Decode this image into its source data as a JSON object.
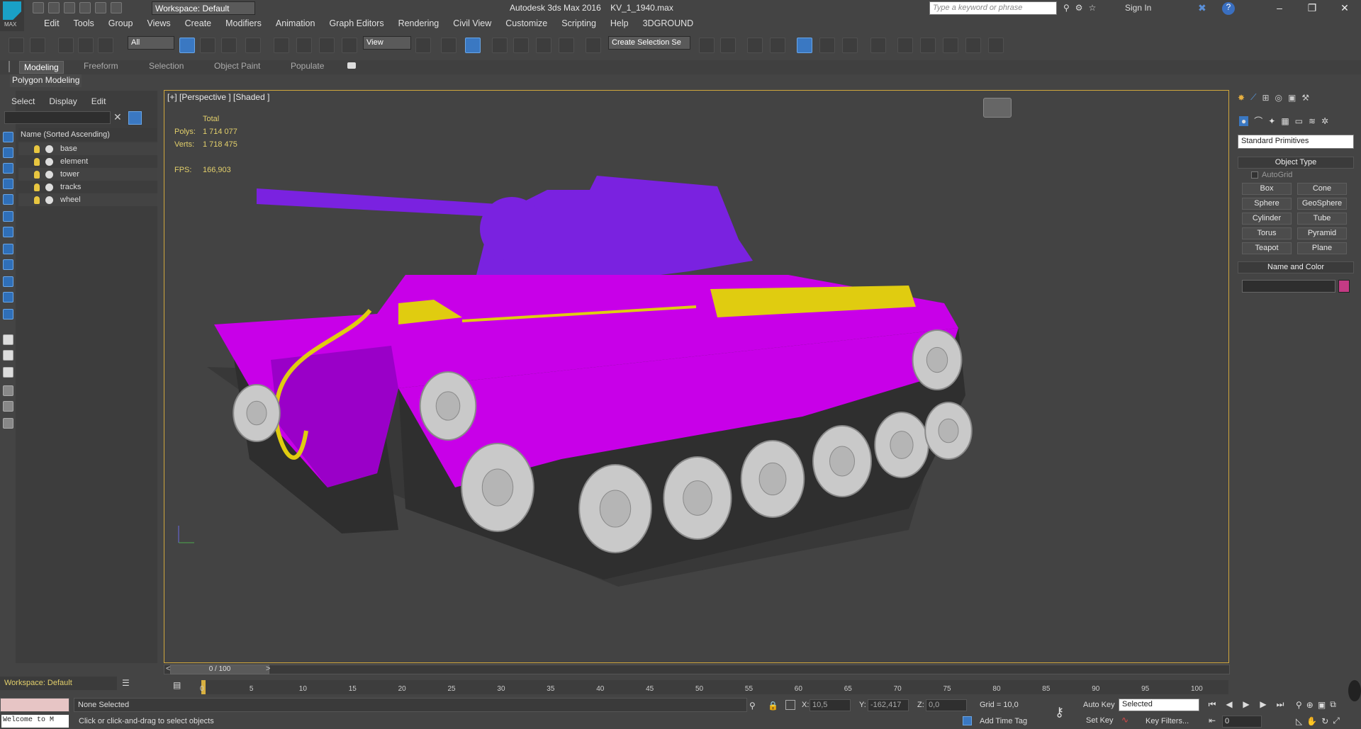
{
  "app": {
    "window_title": "Autodesk 3ds Max 2016",
    "file_name": "KV_1_1940.max",
    "logo_text": "MAX",
    "workspace_label": "Workspace: Default",
    "search_placeholder": "Type a keyword or phrase",
    "sign_in": "Sign In"
  },
  "menu": [
    "Edit",
    "Tools",
    "Group",
    "Views",
    "Create",
    "Modifiers",
    "Animation",
    "Graph Editors",
    "Rendering",
    "Civil View",
    "Customize",
    "Scripting",
    "Help",
    "3DGROUND"
  ],
  "toolbar": {
    "selection_filter": "All",
    "ref_coord": "View",
    "named_selection_placeholder": "Create Selection Se"
  },
  "ribbon": {
    "tabs": [
      "Modeling",
      "Freeform",
      "Selection",
      "Object Paint",
      "Populate"
    ],
    "active_tab": "Modeling",
    "sub_label": "Polygon Modeling"
  },
  "scene_explorer": {
    "menu": [
      "Select",
      "Display",
      "Edit"
    ],
    "column_header": "Name (Sorted Ascending)",
    "objects": [
      "base",
      "element",
      "tower",
      "tracks",
      "wheel"
    ]
  },
  "viewport": {
    "label": "[+] [Perspective ] [Shaded ]",
    "stats": {
      "header": "Total",
      "polys_label": "Polys:",
      "polys": "1 714 077",
      "verts_label": "Verts:",
      "verts": "1 718 475",
      "fps_label": "FPS:",
      "fps": "166,903"
    },
    "colors": {
      "body": "#c800e8",
      "turret": "#7a22e0",
      "details": "#e0cc10",
      "wheels": "#c9c9c9",
      "tracks": "#333333"
    }
  },
  "command_panel": {
    "category": "Standard Primitives",
    "object_type_title": "Object Type",
    "autogrid": "AutoGrid",
    "primitives": [
      "Box",
      "Cone",
      "Sphere",
      "GeoSphere",
      "Cylinder",
      "Tube",
      "Torus",
      "Pyramid",
      "Teapot",
      "Plane"
    ],
    "name_color_title": "Name and Color",
    "object_color": "#c43b84"
  },
  "timeline": {
    "frame": "0 / 100",
    "ticks": [
      "0",
      "5",
      "10",
      "15",
      "20",
      "25",
      "30",
      "35",
      "40",
      "45",
      "50",
      "55",
      "60",
      "65",
      "70",
      "75",
      "80",
      "85",
      "90",
      "95",
      "100"
    ]
  },
  "status": {
    "listener": "Welcome to M",
    "selection": "None Selected",
    "prompt": "Click or click-and-drag to select objects",
    "x_label": "X:",
    "x": "10,5",
    "y_label": "Y:",
    "y": "-162,417",
    "z_label": "Z:",
    "z": "0,0",
    "grid": "Grid = 10,0",
    "add_time_tag": "Add Time Tag",
    "auto_key": "Auto Key",
    "set_key": "Set Key",
    "key_mode": "Selected",
    "key_filters": "Key Filters...",
    "current_frame": "0"
  }
}
